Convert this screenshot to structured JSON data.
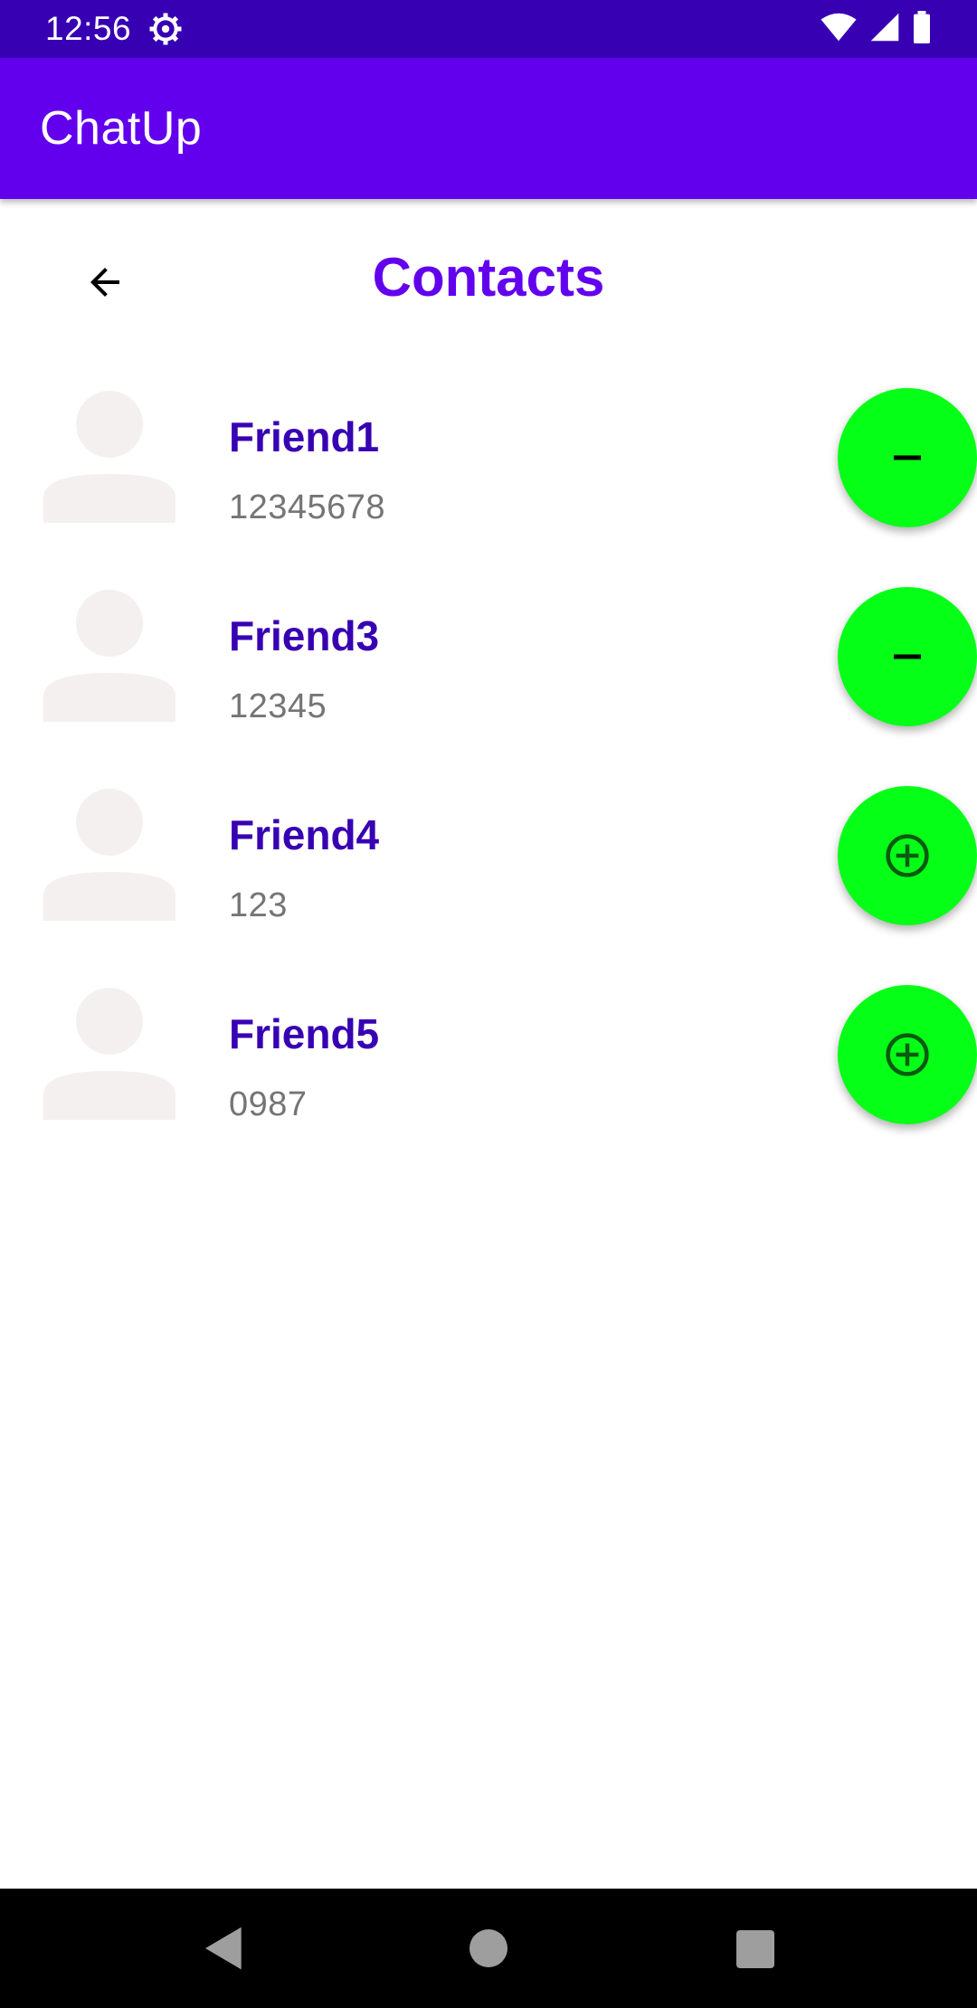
{
  "status_bar": {
    "time": "12:56",
    "icons": [
      "settings-gear-icon",
      "wifi-icon",
      "signal-icon",
      "battery-icon"
    ]
  },
  "app_bar": {
    "title": "ChatUp"
  },
  "header": {
    "title": "Contacts",
    "back_icon": "arrow-back-icon"
  },
  "contacts": [
    {
      "name": "Friend1",
      "phone": "12345678",
      "action": "remove",
      "action_icon": "minus-icon"
    },
    {
      "name": "Friend3",
      "phone": "12345",
      "action": "remove",
      "action_icon": "minus-icon"
    },
    {
      "name": "Friend4",
      "phone": "123",
      "action": "add",
      "action_icon": "plus-circle-icon"
    },
    {
      "name": "Friend5",
      "phone": "0987",
      "action": "add",
      "action_icon": "plus-circle-icon"
    }
  ],
  "colors": {
    "status_bar": "#3700B3",
    "app_bar": "#6200EE",
    "title": "#6200EE",
    "contact_name": "#3700B3",
    "fab": "#05FF17",
    "avatar": "#F5F0F0"
  },
  "nav_bar": {
    "icons": [
      "nav-back-icon",
      "nav-home-icon",
      "nav-recents-icon"
    ]
  }
}
